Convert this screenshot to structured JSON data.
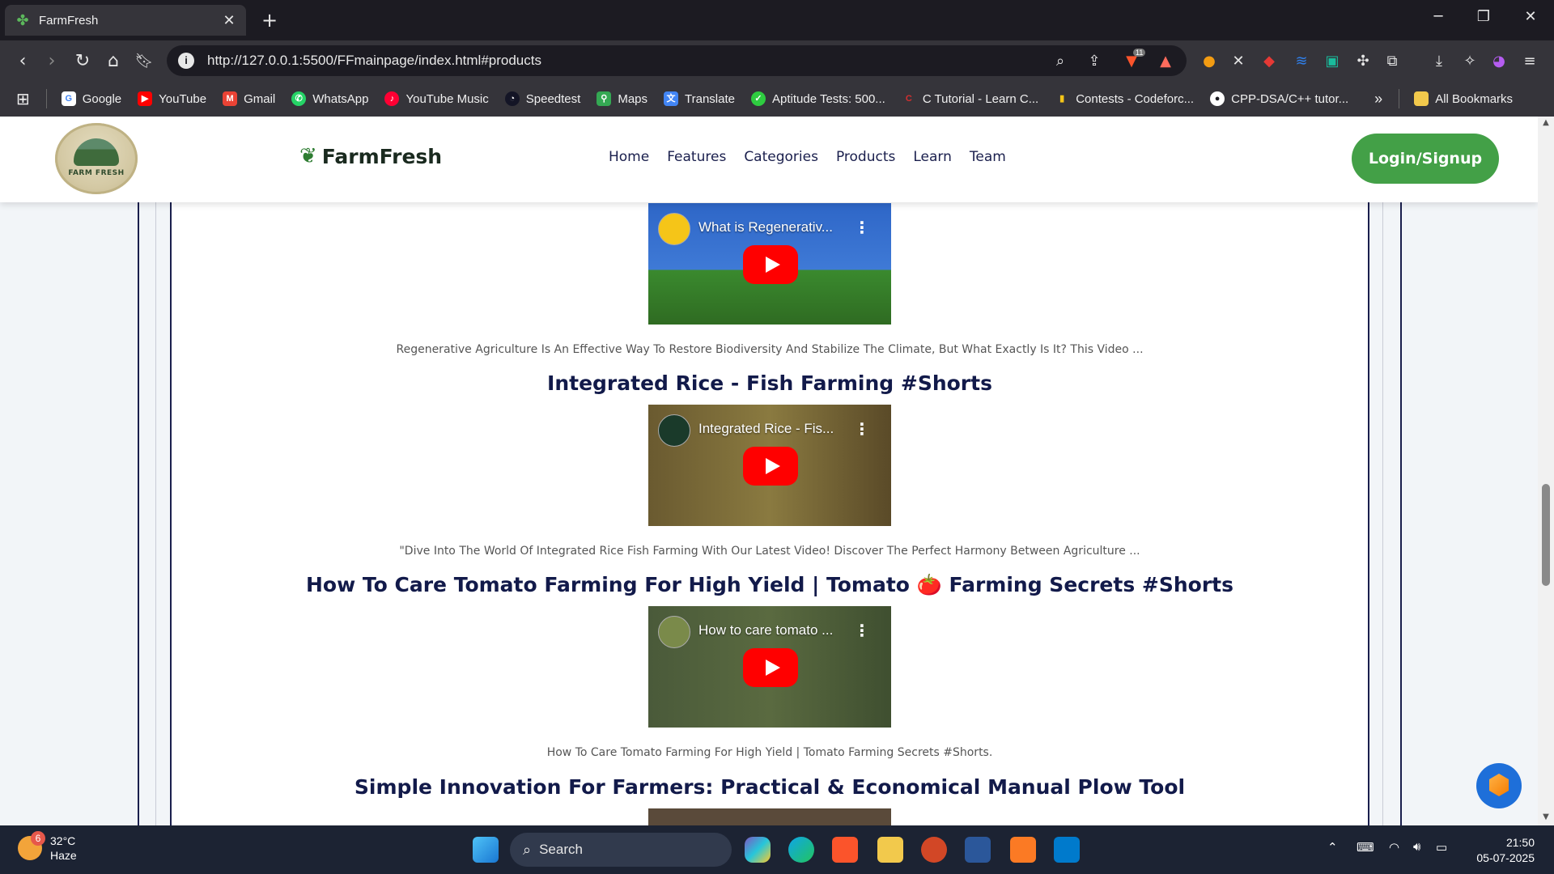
{
  "browser": {
    "tab_title": "FarmFresh",
    "url": "http://127.0.0.1:5500/FFmainpage/index.html#products",
    "bookmarks": [
      {
        "label": "Google",
        "icon": "google-icon",
        "color": "#4285f4"
      },
      {
        "label": "YouTube",
        "icon": "youtube-icon",
        "color": "#ff0000"
      },
      {
        "label": "Gmail",
        "icon": "gmail-icon",
        "color": "#ea4335"
      },
      {
        "label": "WhatsApp",
        "icon": "whatsapp-icon",
        "color": "#25d366"
      },
      {
        "label": "YouTube Music",
        "icon": "youtube-music-icon",
        "color": "#ff0033"
      },
      {
        "label": "Speedtest",
        "icon": "speedtest-icon",
        "color": "#141526"
      },
      {
        "label": "Maps",
        "icon": "maps-icon",
        "color": "#34a853"
      },
      {
        "label": "Translate",
        "icon": "translate-icon",
        "color": "#4285f4"
      },
      {
        "label": "Aptitude Tests: 500...",
        "icon": "aptitude-icon",
        "color": "#2ecc40"
      },
      {
        "label": "C Tutorial - Learn C...",
        "icon": "c-tutorial-icon",
        "color": "#d32f2f"
      },
      {
        "label": "Contests - Codeforc...",
        "icon": "codeforces-icon",
        "color": "#f5c518"
      },
      {
        "label": "CPP-DSA/C++ tutor...",
        "icon": "github-icon",
        "color": "#ffffff"
      }
    ],
    "more_label": "»",
    "all_bookmarks": "All Bookmarks",
    "extension_badge": "11"
  },
  "site": {
    "logo_text": "FARM FRESH",
    "brand": "FarmFresh",
    "nav": [
      "Home",
      "Features",
      "Categories",
      "Products",
      "Learn",
      "Team"
    ],
    "login": "Login/Signup",
    "accent": "#43a047",
    "heading_color": "#121a4a"
  },
  "videos": [
    {
      "heading": "",
      "player_title": "What is Regenerativ...",
      "description": "Regenerative Agriculture Is An Effective Way To Restore Biodiversity And Stabilize The Climate, But What Exactly Is It? This Video ..."
    },
    {
      "heading": "Integrated Rice - Fish Farming #Shorts",
      "player_title": "Integrated Rice - Fis...",
      "description": "\"Dive Into The World Of Integrated Rice Fish Farming With Our Latest Video! Discover The Perfect Harmony Between Agriculture ..."
    },
    {
      "heading": "How To Care Tomato Farming For High Yield | Tomato 🍅 Farming Secrets #Shorts",
      "player_title": "How to care tomato ...",
      "description": "How To Care Tomato Farming For High Yield | Tomato Farming Secrets #Shorts."
    },
    {
      "heading": "Simple Innovation For Farmers: Practical & Economical Manual Plow Tool",
      "player_title": "",
      "description": ""
    }
  ],
  "taskbar": {
    "weather_badge": "6",
    "temperature": "32°C",
    "condition": "Haze",
    "search_placeholder": "Search",
    "time": "21:50",
    "date": "05-07-2025"
  }
}
